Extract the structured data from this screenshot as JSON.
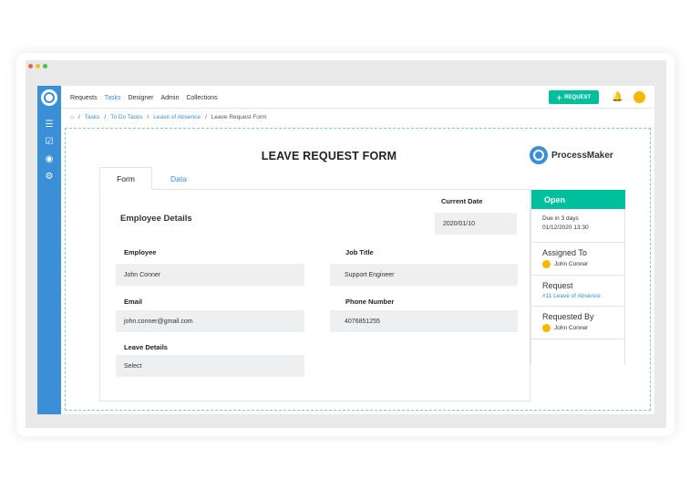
{
  "nav": {
    "items": [
      "Requests",
      "Tasks",
      "Designer",
      "Admin",
      "Collections"
    ],
    "active_index": 1,
    "request_button": "REQUEST"
  },
  "breadcrumbs": [
    "Tasks",
    "To Do Tasks",
    "Leave of Absence",
    "Leave Request Form"
  ],
  "form": {
    "title": "LEAVE REQUEST FORM",
    "brand": "ProcessMaker",
    "tabs": [
      "Form",
      "Data"
    ],
    "current_date_label": "Current Date",
    "current_date_value": "2020/01/10",
    "section_title": "Employee Details",
    "employee_label": "Employee",
    "employee_value": "John Conner",
    "job_title_label": "Job Title",
    "job_title_value": "Support Engineer",
    "email_label": "Email",
    "email_value": "john.conner@gmail.com",
    "phone_label": "Phone Number",
    "phone_value": "4076851255",
    "leave_label": "Leave Details",
    "leave_value": "Select"
  },
  "panel": {
    "status": "Open",
    "due_text": "Due in 3 days",
    "due_date": "01/12/2020 13:30",
    "assigned_to_label": "Assigned To",
    "assigned_to_name": "John Conner",
    "request_label": "Request",
    "request_link": "#11 Leave of Absence",
    "requested_by_label": "Requested By",
    "requested_by_name": "John Conner"
  },
  "colors": {
    "sidebar": "#3b8fd6",
    "accent_green": "#00bf9c",
    "avatar": "#f5b700"
  }
}
